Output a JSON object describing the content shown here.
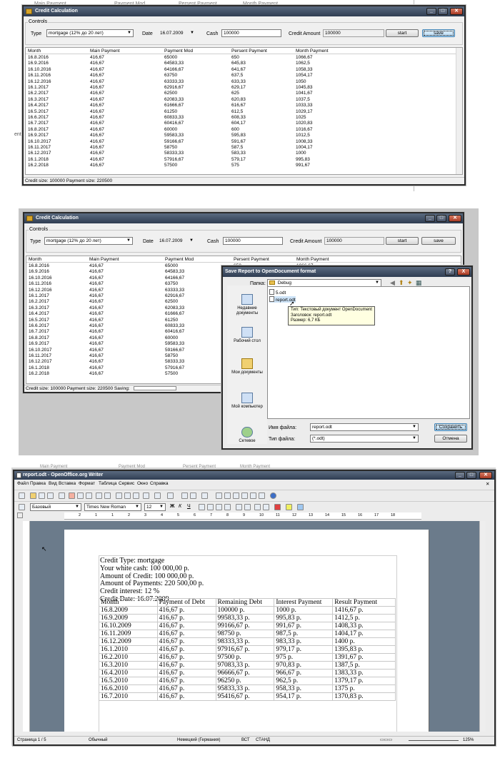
{
  "shot1": {
    "bg_menu": [
      "Main Payment",
      "Payment Mod",
      "Persent Payment",
      "Month Payment"
    ],
    "bg_text": "ent",
    "window_title": "Credit Calculation",
    "controls_label": "Controls",
    "type_label": "Type",
    "type_value": "mortgage (12% до 20 лет)",
    "date_label": "Date",
    "date_value": "16.07.2009",
    "cash_label": "Cash",
    "cash_value": "100000",
    "credit_amount_label": "Credit Amount",
    "credit_amount_value": "100000",
    "start_label": "start",
    "save_label": "save",
    "columns": [
      "Month",
      "Main Payment",
      "Payment Mod",
      "Persent Payment",
      "Month Payment"
    ],
    "rows": [
      [
        "16.8.2016",
        "416,67",
        "65000",
        "650",
        "1066,67"
      ],
      [
        "16.9.2016",
        "416,67",
        "64583,33",
        "645,83",
        "1062,5"
      ],
      [
        "16.10.2016",
        "416,67",
        "64166,67",
        "641,67",
        "1058,33"
      ],
      [
        "16.11.2016",
        "416,67",
        "63750",
        "637,5",
        "1054,17"
      ],
      [
        "16.12.2016",
        "416,67",
        "63333,33",
        "633,33",
        "1050"
      ],
      [
        "16.1.2017",
        "416,67",
        "62916,67",
        "629,17",
        "1045,83"
      ],
      [
        "16.2.2017",
        "416,67",
        "62500",
        "625",
        "1041,67"
      ],
      [
        "16.3.2017",
        "416,67",
        "62083,33",
        "620,83",
        "1037,5"
      ],
      [
        "16.4.2017",
        "416,67",
        "61666,67",
        "616,67",
        "1033,33"
      ],
      [
        "16.5.2017",
        "416,67",
        "61250",
        "612,5",
        "1029,17"
      ],
      [
        "16.6.2017",
        "416,67",
        "60833,33",
        "608,33",
        "1025"
      ],
      [
        "16.7.2017",
        "416,67",
        "60416,67",
        "604,17",
        "1020,83"
      ],
      [
        "16.8.2017",
        "416,67",
        "60000",
        "600",
        "1016,67"
      ],
      [
        "16.9.2017",
        "416,67",
        "59583,33",
        "595,83",
        "1012,5"
      ],
      [
        "16.10.2017",
        "416,67",
        "59166,67",
        "591,67",
        "1008,33"
      ],
      [
        "16.11.2017",
        "416,67",
        "58750",
        "587,5",
        "1004,17"
      ],
      [
        "16.12.2017",
        "416,67",
        "58333,33",
        "583,33",
        "1000"
      ],
      [
        "16.1.2018",
        "416,67",
        "57916,67",
        "579,17",
        "995,83"
      ],
      [
        "16.2.2018",
        "416,67",
        "57500",
        "575",
        "991,67"
      ]
    ],
    "status": "Credit size: 100000   Payment size: 220500"
  },
  "shot2": {
    "window_title": "Credit Calculation",
    "controls_label": "Controls",
    "type_label": "Type",
    "type_value": "mortgage (12% до 20 лет)",
    "date_label": "Date",
    "date_value": "16.07.2009",
    "cash_label": "Cash",
    "cash_value": "100000",
    "credit_amount_label": "Credit Amount",
    "credit_amount_value": "100000",
    "start_label": "start",
    "save_label": "save",
    "columns": [
      "Month",
      "Main Payment",
      "Payment Mod",
      "Persent Payment",
      "Month Payment"
    ],
    "rows": [
      [
        "16.8.2016",
        "416,67",
        "65000",
        "650",
        "1066,67"
      ],
      [
        "16.9.2016",
        "416,67",
        "64583,33"
      ],
      [
        "16.10.2016",
        "416,67",
        "64166,67"
      ],
      [
        "16.11.2016",
        "416,67",
        "63750"
      ],
      [
        "16.12.2016",
        "416,67",
        "63333,33"
      ],
      [
        "16.1.2017",
        "416,67",
        "62916,67"
      ],
      [
        "16.2.2017",
        "416,67",
        "62500"
      ],
      [
        "16.3.2017",
        "416,67",
        "62083,33"
      ],
      [
        "16.4.2017",
        "416,67",
        "61666,67"
      ],
      [
        "16.5.2017",
        "416,67",
        "61250"
      ],
      [
        "16.6.2017",
        "416,67",
        "60833,33"
      ],
      [
        "16.7.2017",
        "416,67",
        "60416,67"
      ],
      [
        "16.8.2017",
        "416,67",
        "60000"
      ],
      [
        "16.9.2017",
        "416,67",
        "59583,33"
      ],
      [
        "16.10.2017",
        "416,67",
        "59166,67"
      ],
      [
        "16.11.2017",
        "416,67",
        "58750"
      ],
      [
        "16.12.2017",
        "416,67",
        "58333,33"
      ],
      [
        "16.1.2018",
        "416,67",
        "57916,67"
      ],
      [
        "16.2.2018",
        "416,67",
        "57500"
      ]
    ],
    "status": "Credit size: 100000   Payment size: 220500   Saving:",
    "dialog": {
      "title": "Save Report to OpenDocument format",
      "folder_label": "Папка:",
      "folder_value": "Debug",
      "places": [
        "Недавние документы",
        "Рабочий стол",
        "Мои документы",
        "Мой компьютер",
        "Сетевое"
      ],
      "files": [
        "5.odt",
        "report.odt"
      ],
      "tooltip": [
        "Тип: Текстовый документ OpenDocument",
        "Заголовок: report.odt",
        "Размер: 6,7 КБ"
      ],
      "filename_label": "Имя файла:",
      "filename_value": "report.odt",
      "filetype_label": "Тип файла:",
      "filetype_value": "(*.odt)",
      "save_label": "Сохранить",
      "cancel_label": "Отмена",
      "help_label": "?",
      "close_label": "X"
    }
  },
  "shot3": {
    "bg_text": [
      "Main Payment",
      "Payment Mod",
      "Persent Payment",
      "Month Payment"
    ],
    "window_title": "report.odt - OpenOffice.org Writer",
    "menu": [
      "Файл",
      "Правка",
      "Вид",
      "Вставка",
      "Формат",
      "Таблица",
      "Сервис",
      "Окно",
      "Справка"
    ],
    "style_value": "Базовый",
    "font_value": "Times New Roman",
    "size_value": "12",
    "format_buttons": [
      "Ж",
      "К",
      "Ч"
    ],
    "ruler_numbers": [
      "2",
      "1",
      "1",
      "2",
      "3",
      "4",
      "5",
      "6",
      "7",
      "8",
      "9",
      "10",
      "11",
      "12",
      "13",
      "14",
      "15",
      "16",
      "17",
      "18"
    ],
    "doc_lines": [
      "Credit Type: mortgage",
      "Your white cash: 100 000,00 р.",
      "Amount of Credit: 100 000,00 р.",
      "Amount of Payments: 220 500,00 р.",
      "Credit interest: 12 %",
      "Credit Date: 16.07.2009"
    ],
    "table_header": [
      "Month",
      "Payment of Debt",
      "Remaining Debt",
      "Interest Payment",
      "Result Payment"
    ],
    "table_rows": [
      [
        "16.8.2009",
        "416,67 р.",
        "100000 р.",
        "1000 р.",
        "1416,67 р."
      ],
      [
        "16.9.2009",
        "416,67 р.",
        "99583,33 р.",
        "995,83 р.",
        "1412,5 р."
      ],
      [
        "16.10.2009",
        "416,67 р.",
        "99166,67 р.",
        "991,67 р.",
        "1408,33 р."
      ],
      [
        "16.11.2009",
        "416,67 р.",
        "98750 р.",
        "987,5 р.",
        "1404,17 р."
      ],
      [
        "16.12.2009",
        "416,67 р.",
        "98333,33 р.",
        "983,33 р.",
        "1400 р."
      ],
      [
        "16.1.2010",
        "416,67 р.",
        "97916,67 р.",
        "979,17 р.",
        "1395,83 р."
      ],
      [
        "16.2.2010",
        "416,67 р.",
        "97500 р.",
        "975 р.",
        "1391,67 р."
      ],
      [
        "16.3.2010",
        "416,67 р.",
        "97083,33 р.",
        "970,83 р.",
        "1387,5 р."
      ],
      [
        "16.4.2010",
        "416,67 р.",
        "96666,67 р.",
        "966,67 р.",
        "1383,33 р."
      ],
      [
        "16.5.2010",
        "416,67 р.",
        "96250 р.",
        "962,5 р.",
        "1379,17 р."
      ],
      [
        "16.6.2010",
        "416,67 р.",
        "95833,33 р.",
        "958,33 р.",
        "1375 р."
      ],
      [
        "16.7.2010",
        "416,67 р.",
        "95416,67 р.",
        "954,17 р.",
        "1370,83 р."
      ]
    ],
    "statusbar": [
      "Страница 1 / 5",
      "Обычный",
      "Немецкий (Германия)",
      "ВСТ",
      "СТАНД",
      "125%"
    ]
  }
}
